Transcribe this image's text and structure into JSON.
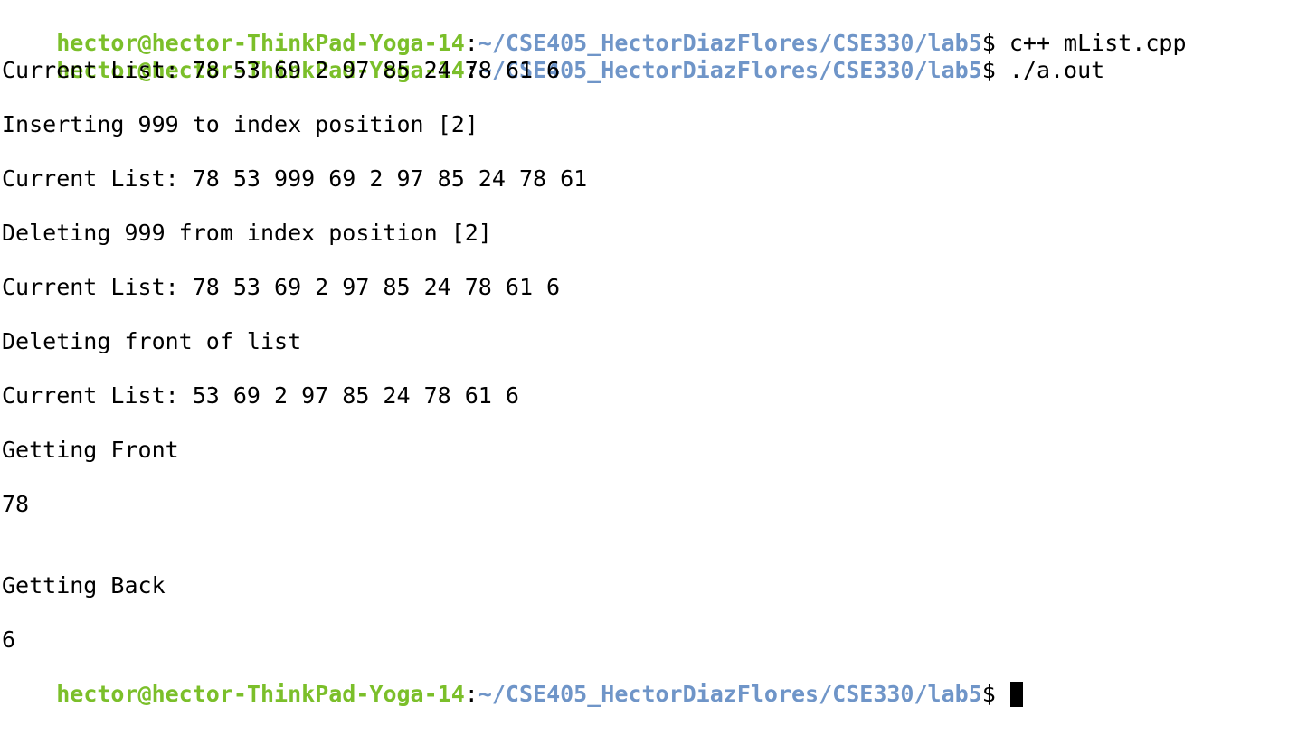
{
  "prompt": {
    "user_host": "hector@hector-ThinkPad-Yoga-14",
    "separator": ":",
    "path": "~/CSE405_HectorDiazFlores/CSE330/lab5",
    "dollar": "$"
  },
  "commands": [
    " c++ mList.cpp",
    " ./a.out"
  ],
  "output": [
    "Current List: 78 53 69 2 97 85 24 78 61 6",
    "",
    "Inserting 999 to index position [2]",
    "",
    "Current List: 78 53 999 69 2 97 85 24 78 61",
    "",
    "Deleting 999 from index position [2]",
    "",
    "Current List: 78 53 69 2 97 85 24 78 61 6",
    "",
    "Deleting front of list",
    "",
    "Current List: 53 69 2 97 85 24 78 61 6",
    "",
    "Getting Front",
    "",
    "78",
    "",
    "",
    "Getting Back",
    "",
    "6"
  ],
  "colors": {
    "user_host": "#7bbf2a",
    "path": "#6f95c8",
    "text": "#000000",
    "background": "#ffffff"
  }
}
